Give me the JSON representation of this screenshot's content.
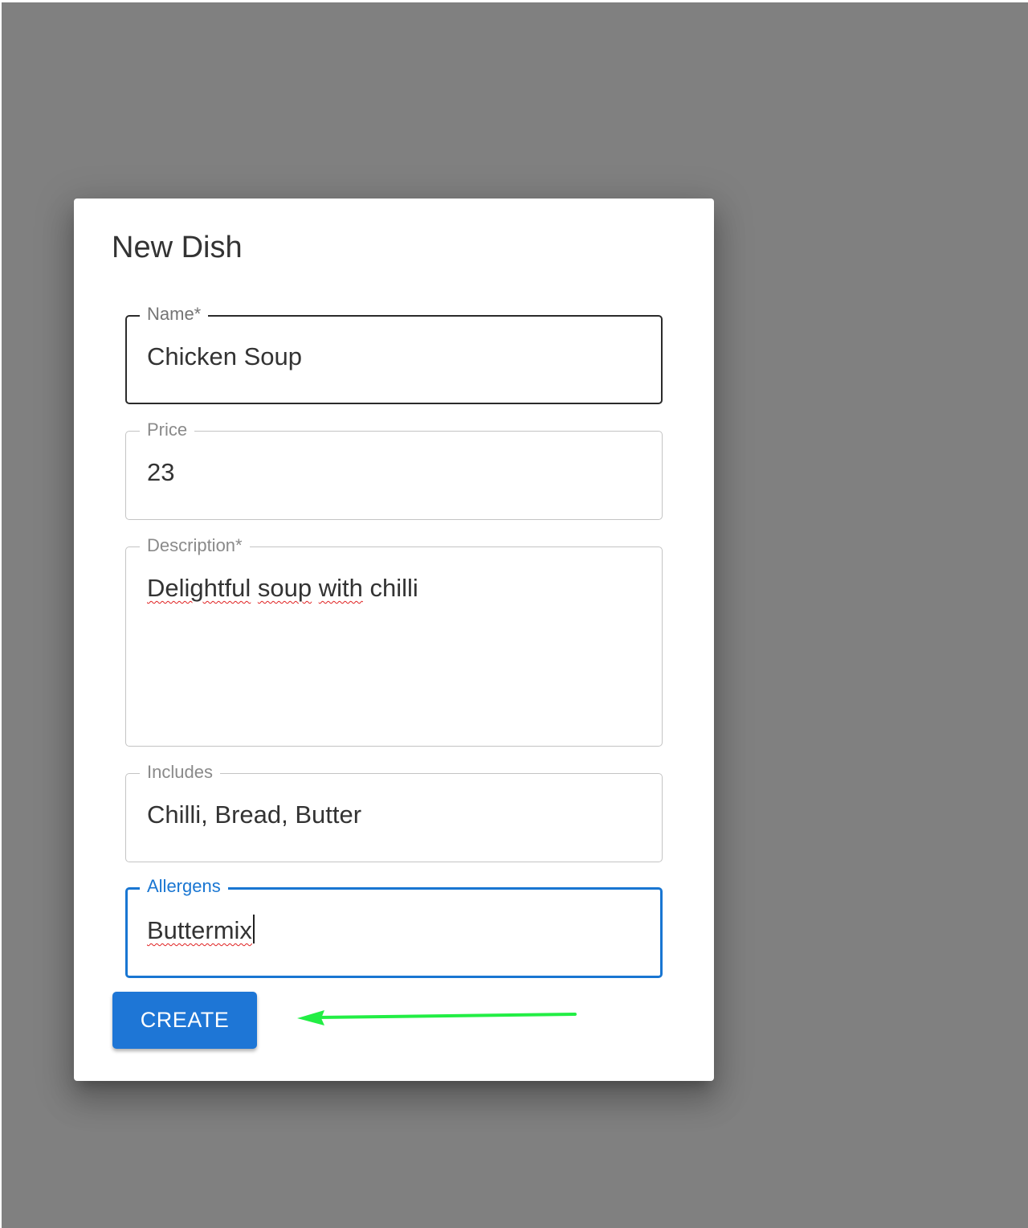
{
  "dialog": {
    "title": "New Dish",
    "fields": [
      {
        "label": "Name*",
        "value": "Chicken Soup"
      },
      {
        "label": "Price",
        "value": "23"
      },
      {
        "label": "Description*",
        "value_parts": [
          "Delightful",
          "soup",
          "with",
          "chilli"
        ]
      },
      {
        "label": "Includes",
        "value": "Chilli, Bread, Butter"
      },
      {
        "label": "Allergens",
        "value": "Buttermix"
      }
    ],
    "create_label": "CREATE"
  },
  "colors": {
    "backdrop": "#808080",
    "primary": "#1976d2",
    "button": "#1e76d6",
    "annotation_arrow": "#22ee44"
  },
  "icons": {
    "annotation": "arrow-left-icon"
  }
}
